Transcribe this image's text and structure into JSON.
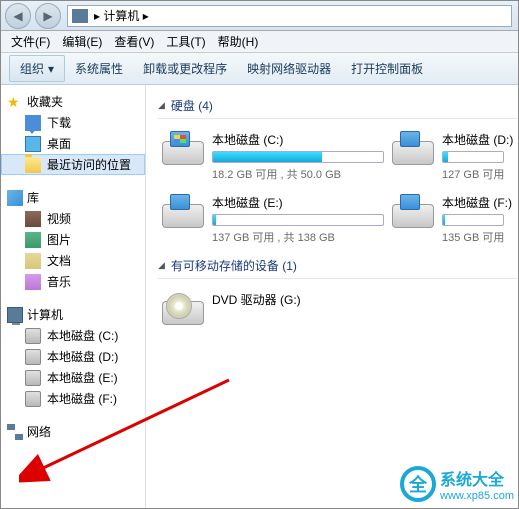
{
  "address": {
    "location": "计算机",
    "sep": "▸"
  },
  "menu": [
    "文件(F)",
    "编辑(E)",
    "查看(V)",
    "工具(T)",
    "帮助(H)"
  ],
  "toolbar": {
    "organize": "组织",
    "sys_props": "系统属性",
    "uninstall": "卸载或更改程序",
    "map_drive": "映射网络驱动器",
    "control_panel": "打开控制面板"
  },
  "sidebar": {
    "favorites": {
      "label": "收藏夹",
      "items": [
        {
          "label": "下载"
        },
        {
          "label": "桌面"
        },
        {
          "label": "最近访问的位置"
        }
      ]
    },
    "libraries": {
      "label": "库",
      "items": [
        {
          "label": "视频"
        },
        {
          "label": "图片"
        },
        {
          "label": "文档"
        },
        {
          "label": "音乐"
        }
      ]
    },
    "computer": {
      "label": "计算机",
      "items": [
        {
          "label": "本地磁盘 (C:)"
        },
        {
          "label": "本地磁盘 (D:)"
        },
        {
          "label": "本地磁盘 (E:)"
        },
        {
          "label": "本地磁盘 (F:)"
        }
      ]
    },
    "network": {
      "label": "网络"
    }
  },
  "content": {
    "hdd_section": "硬盘 (4)",
    "removable_section": "有可移动存储的设备 (1)",
    "drives": [
      {
        "name": "本地磁盘 (C:)",
        "stat": "18.2 GB 可用 , 共 50.0 GB",
        "fill": 64,
        "win": true
      },
      {
        "name": "本地磁盘 (D:)",
        "stat": "127 GB 可用",
        "fill": 8
      },
      {
        "name": "本地磁盘 (E:)",
        "stat": "137 GB 可用 , 共 138 GB",
        "fill": 2
      },
      {
        "name": "本地磁盘 (F:)",
        "stat": "135 GB 可用",
        "fill": 3
      }
    ],
    "dvd": {
      "name": "DVD 驱动器 (G:)"
    }
  },
  "watermark": {
    "brand": "系统大全",
    "url": "www.xp85.com",
    "glyph": "全"
  }
}
